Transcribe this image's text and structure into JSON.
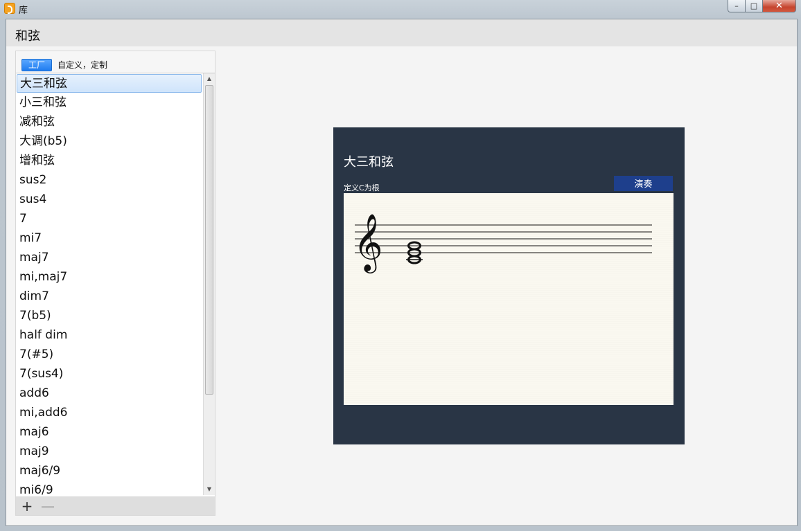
{
  "window": {
    "title": "库",
    "controls": {
      "minimize": "–",
      "maximize": "□",
      "close": "✕"
    }
  },
  "header": {
    "title": "和弦"
  },
  "tabs": [
    {
      "label": "工厂",
      "active": true
    },
    {
      "label": "自定义，定制",
      "active": false
    }
  ],
  "chord_list": {
    "selected_index": 0,
    "items": [
      "大三和弦",
      "小三和弦",
      "减和弦",
      "大调(b5)",
      "增和弦",
      "sus2",
      "sus4",
      "7",
      "mi7",
      "maj7",
      "mi,maj7",
      "dim7",
      "7(b5)",
      "half dim",
      "7(#5)",
      "7(sus4)",
      "add6",
      "mi,add6",
      "maj6",
      "maj9",
      "maj6/9",
      "mi6/9"
    ]
  },
  "list_actions": {
    "add": "+",
    "remove": "—"
  },
  "detail": {
    "chord_name": "大三和弦",
    "root_label": "定义C为根",
    "play_label": "演奏",
    "notes": [
      "C4",
      "E4",
      "G4"
    ],
    "clef": "treble"
  },
  "colors": {
    "card_bg": "#293545",
    "play_button": "#1e3f8c",
    "score_bg": "#faf8f0",
    "tab_active": "#1f7cf0"
  }
}
